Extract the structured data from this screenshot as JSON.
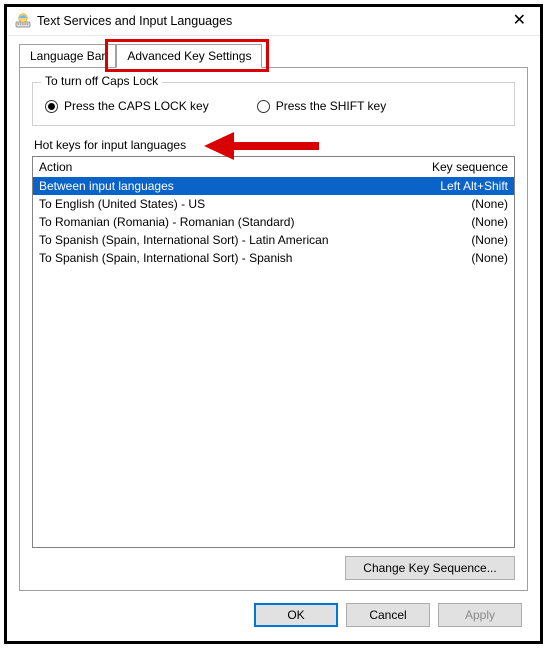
{
  "window": {
    "title": "Text Services and Input Languages"
  },
  "tabs": {
    "language_bar": "Language Bar",
    "advanced_key_settings": "Advanced Key Settings"
  },
  "capslock_group": {
    "title": "To turn off Caps Lock",
    "option_capslock": "Press the CAPS LOCK key",
    "option_shift": "Press the SHIFT key"
  },
  "hotkeys": {
    "section_label": "Hot keys for input languages",
    "header_action": "Action",
    "header_keyseq": "Key sequence",
    "rows": [
      {
        "action": "Between input languages",
        "keyseq": "Left Alt+Shift",
        "selected": true
      },
      {
        "action": "To English (United States) - US",
        "keyseq": "(None)",
        "selected": false
      },
      {
        "action": "To Romanian (Romania) - Romanian (Standard)",
        "keyseq": "(None)",
        "selected": false
      },
      {
        "action": "To Spanish (Spain, International Sort) - Latin American",
        "keyseq": "(None)",
        "selected": false
      },
      {
        "action": "To Spanish (Spain, International Sort) - Spanish",
        "keyseq": "(None)",
        "selected": false
      }
    ]
  },
  "buttons": {
    "change_key_sequence": "Change Key Sequence...",
    "ok": "OK",
    "cancel": "Cancel",
    "apply": "Apply"
  }
}
